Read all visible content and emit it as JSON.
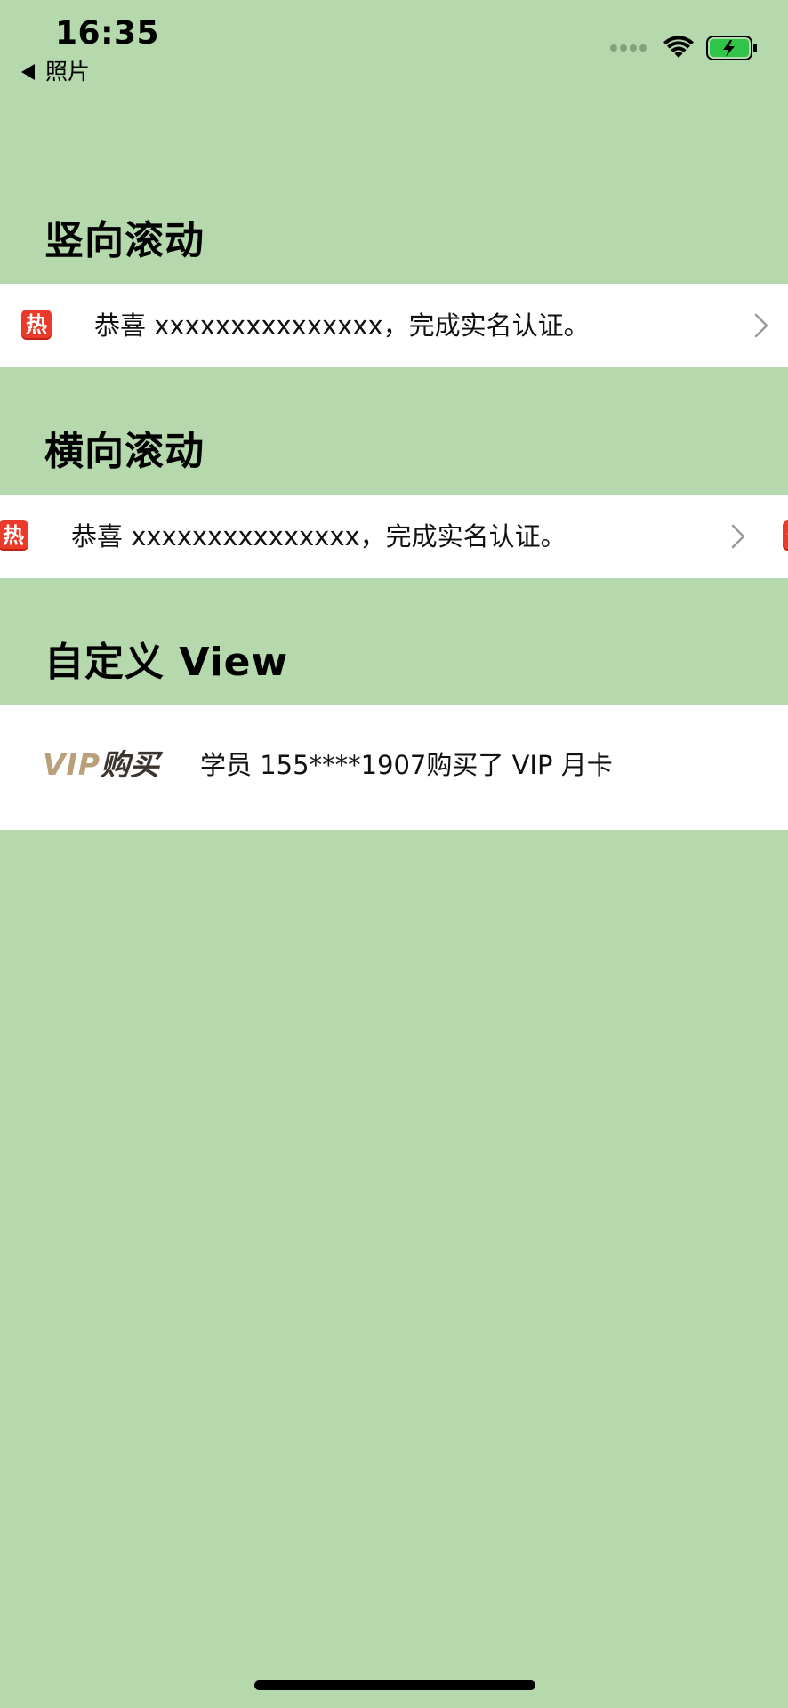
{
  "status_bar": {
    "time": "16:35",
    "back_label": "照片",
    "icons": [
      "signal-dots-icon",
      "wifi-icon",
      "battery-charging-icon"
    ],
    "battery_color": "#30c548"
  },
  "colors": {
    "background": "#b5d8ad",
    "row_background": "#ffffff",
    "hot_badge": "#ea3b2a",
    "vip_gold": "#b9a07a"
  },
  "sections": {
    "vertical": {
      "title": "竖向滚动",
      "badge": "热",
      "text": "恭喜 xxxxxxxxxxxxxxx，完成实名认证。"
    },
    "horizontal": {
      "title": "横向滚动",
      "badge": "热",
      "text": "恭喜 xxxxxxxxxxxxxxx，完成实名认证。",
      "next_badge": "热"
    },
    "custom": {
      "title": "自定义 View",
      "logo_vip": "VIP",
      "logo_buy": "购买",
      "text": "学员 155****1907购买了 VIP 月卡"
    }
  }
}
